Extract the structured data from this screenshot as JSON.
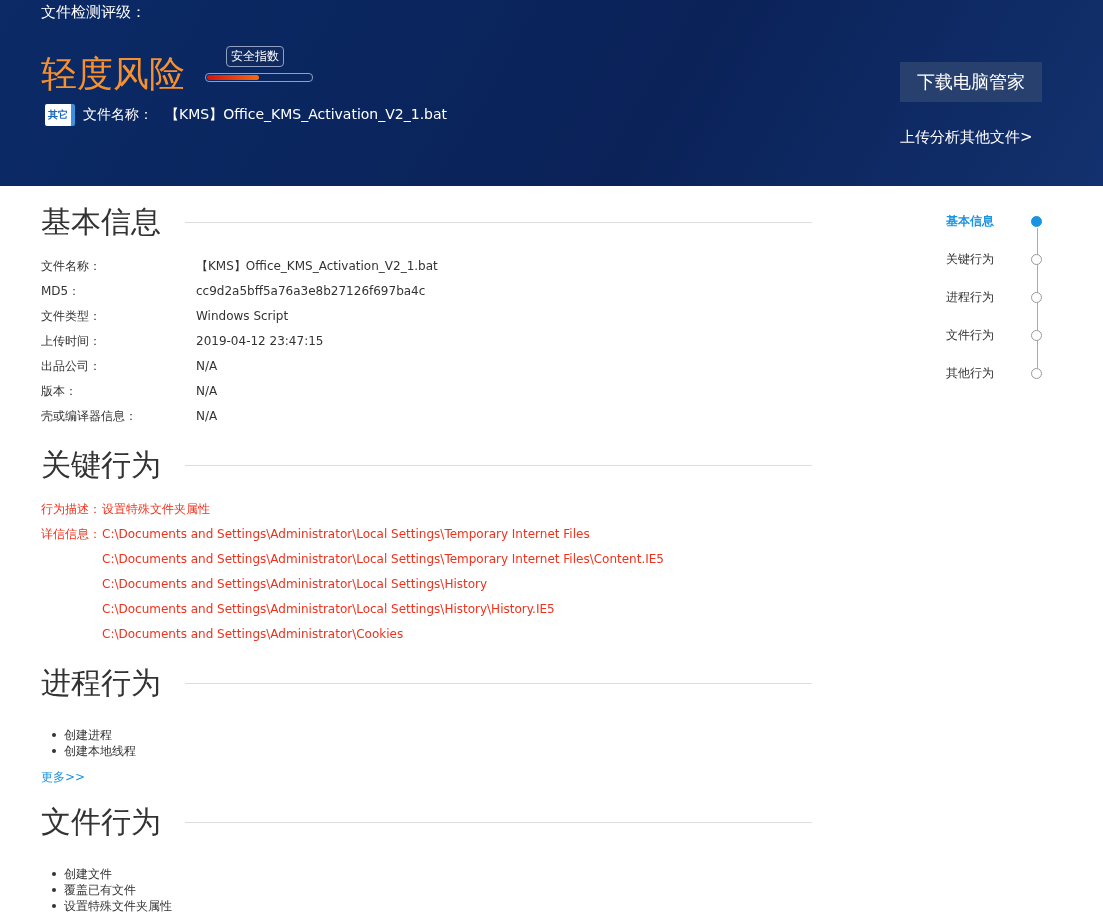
{
  "header": {
    "title": "文件检测评级：",
    "risk": "轻度风险",
    "score": {
      "label": "安全指数",
      "level": 0.5
    },
    "file_badge": "其它",
    "file_label": "文件名称：",
    "file_name": "【KMS】Office_KMS_Activation_V2_1.bat",
    "download_button": "下载电脑管家",
    "upload_link": "上传分析其他文件>"
  },
  "basic": {
    "title": "基本信息",
    "rows": [
      {
        "label": "文件名称：",
        "value": "【KMS】Office_KMS_Activation_V2_1.bat"
      },
      {
        "label": "MD5：",
        "value": "cc9d2a5bff5a76a3e8b27126f697ba4c"
      },
      {
        "label": "文件类型：",
        "value": "Windows Script"
      },
      {
        "label": "上传时间：",
        "value": "2019-04-12 23:47:15"
      },
      {
        "label": "出品公司：",
        "value": "N/A"
      },
      {
        "label": "版本：",
        "value": "N/A"
      },
      {
        "label": "壳或编译器信息：",
        "value": "N/A"
      }
    ]
  },
  "key": {
    "title": "关键行为",
    "desc_label": "行为描述：",
    "desc": "设置特殊文件夹属性",
    "detail_label": "详信信息：",
    "details": [
      "C:\\Documents and Settings\\Administrator\\Local Settings\\Temporary Internet Files",
      "C:\\Documents and Settings\\Administrator\\Local Settings\\Temporary Internet Files\\Content.IE5",
      "C:\\Documents and Settings\\Administrator\\Local Settings\\History",
      "C:\\Documents and Settings\\Administrator\\Local Settings\\History\\History.IE5",
      "C:\\Documents and Settings\\Administrator\\Cookies"
    ]
  },
  "process": {
    "title": "进程行为",
    "items": [
      "创建进程",
      "创建本地线程"
    ],
    "more": "更多>>"
  },
  "file": {
    "title": "文件行为",
    "items": [
      "创建文件",
      "覆盖已有文件",
      "设置特殊文件夹属性"
    ]
  },
  "nav": [
    {
      "label": "基本信息",
      "selected": true
    },
    {
      "label": "关键行为",
      "selected": false
    },
    {
      "label": "进程行为",
      "selected": false
    },
    {
      "label": "文件行为",
      "selected": false
    },
    {
      "label": "其他行为",
      "selected": false
    }
  ]
}
